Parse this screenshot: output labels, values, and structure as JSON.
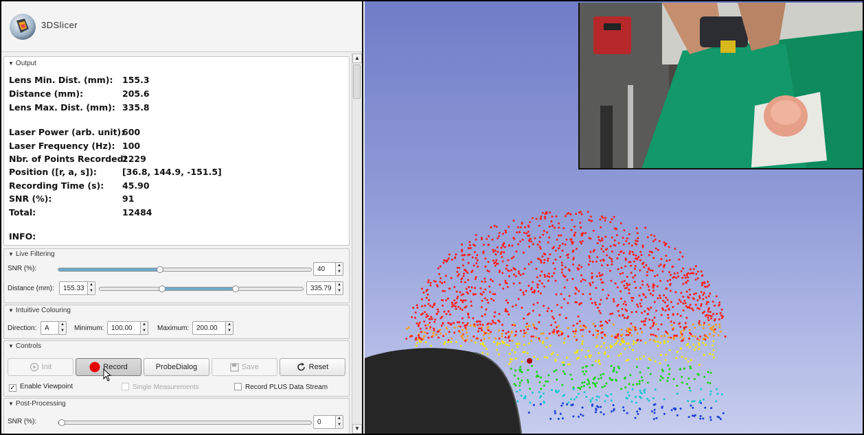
{
  "app": {
    "name": "3DSlicer"
  },
  "output": {
    "section_title": "Output",
    "rows": [
      {
        "label": "Lens Min. Dist. (mm):",
        "value": "155.3"
      },
      {
        "label": "Distance (mm):",
        "value": "205.6"
      },
      {
        "label": "Lens Max. Dist. (mm):",
        "value": "335.8"
      },
      {
        "label": "Laser Power (arb. unit):",
        "value": "600"
      },
      {
        "label": "Laser Frequency (Hz):",
        "value": "100"
      },
      {
        "label": "Nbr. of Points Recorded:",
        "value": "2229"
      },
      {
        "label": "Position ([r, a, s]):",
        "value": "[36.8, 144.9, -151.5]"
      },
      {
        "label": "Recording Time (s):",
        "value": "45.90"
      },
      {
        "label": "SNR (%):",
        "value": "91"
      },
      {
        "label": "Total:",
        "value": "12484"
      }
    ],
    "info_label": "INFO:"
  },
  "live_filtering": {
    "section_title": "Live Filtering",
    "snr_label": "SNR (%):",
    "snr_value": "40",
    "snr_fraction": 0.4,
    "distance_label": "Distance (mm):",
    "distance_min": "155.33",
    "distance_max": "335.79"
  },
  "intuitive_colouring": {
    "section_title": "Intuitive Colouring",
    "direction_label": "Direction:",
    "direction_value": "A",
    "minimum_label": "Minimum:",
    "minimum_value": "100.00",
    "maximum_label": "Maximum:",
    "maximum_value": "200.00"
  },
  "controls": {
    "section_title": "Controls",
    "init_label": "Init",
    "record_label": "Record",
    "probe_dialog_label": "ProbeDialog",
    "save_label": "Save",
    "reset_label": "Reset",
    "enable_viewpoint_label": "Enable Viewpoint",
    "enable_viewpoint_checked": true,
    "single_measurements_label": "Single Measurements",
    "record_plus_label": "Record PLUS Data Stream"
  },
  "post_processing": {
    "section_title": "Post-Processing",
    "snr_label": "SNR (%):",
    "snr_value": "0",
    "snr_fraction": 0
  },
  "colors": {
    "slider_fill": "#6ea9c9",
    "record_dot": "#e60000",
    "background_top": "#707dc7",
    "background_bottom": "#c7cdee",
    "cloud_red": "#ff1f1f",
    "cloud_yellow": "#f2e600",
    "cloud_green": "#19d419",
    "cloud_blue": "#1a3fd6"
  },
  "icons": [
    "slicer-logo-icon",
    "play-circle-icon",
    "record-dot-icon",
    "save-disk-icon",
    "reset-arrow-icon",
    "mouse-cursor-icon",
    "collapse-triangle-icon"
  ]
}
